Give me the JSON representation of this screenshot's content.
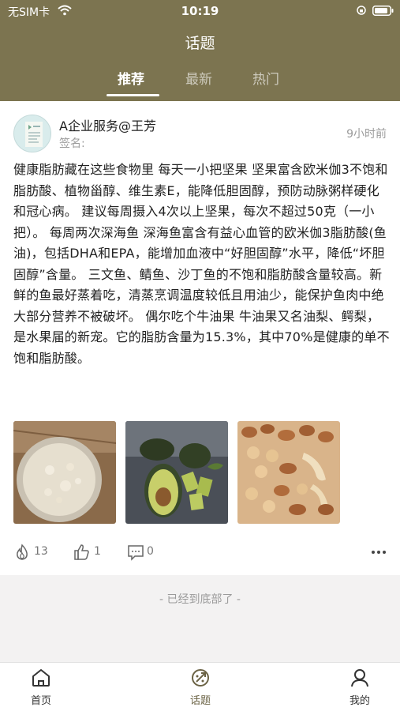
{
  "status_bar": {
    "carrier": "无SIM卡",
    "time": "10:19"
  },
  "header": {
    "title": "话题",
    "tabs": [
      {
        "label": "推荐",
        "active": true
      },
      {
        "label": "最新",
        "active": false
      },
      {
        "label": "热门",
        "active": false
      }
    ]
  },
  "post": {
    "avatar_icon": "avatar-logo",
    "author": "A企业服务@王芳",
    "signature": "签名:",
    "time": "9小时前",
    "text": "健康脂肪藏在这些食物里 每天一小把坚果 坚果富含欧米伽3不饱和脂肪酸、植物甾醇、维生素E，能降低胆固醇，预防动脉粥样硬化和冠心病。 建议每周摄入4次以上坚果，每次不超过50克（一小把）。 每周两次深海鱼 深海鱼富含有益心血管的欧米伽3脂肪酸(鱼油)，包括DHA和EPA，能增加血液中“好胆固醇”水平，降低“坏胆固醇”含量。 三文鱼、鲭鱼、沙丁鱼的不饱和脂肪酸含量较高。新鲜的鱼最好蒸着吃，清蒸烹调温度较低且用油少，能保护鱼肉中绝大部分营养不被破坏。 偶尔吃个牛油果 牛油果又名油梨、鳄梨，是水果届的新宠。它的脂肪含量为15.3%，其中70%是健康的单不饱和脂肪酸。",
    "images": [
      "oats-photo",
      "avocado-photo",
      "nuts-photo"
    ],
    "stats": {
      "hot": "13",
      "likes": "1",
      "comments": "0"
    }
  },
  "end_note": "- 已经到底部了 -",
  "tabbar": {
    "items": [
      {
        "label": "首页",
        "icon": "home-icon"
      },
      {
        "label": "话题",
        "icon": "topic-icon",
        "active": true
      },
      {
        "label": "我的",
        "icon": "profile-icon"
      }
    ]
  },
  "colors": {
    "header": "#7c7450",
    "active_tab": "#6b6345",
    "background": "#f3f2f2"
  }
}
